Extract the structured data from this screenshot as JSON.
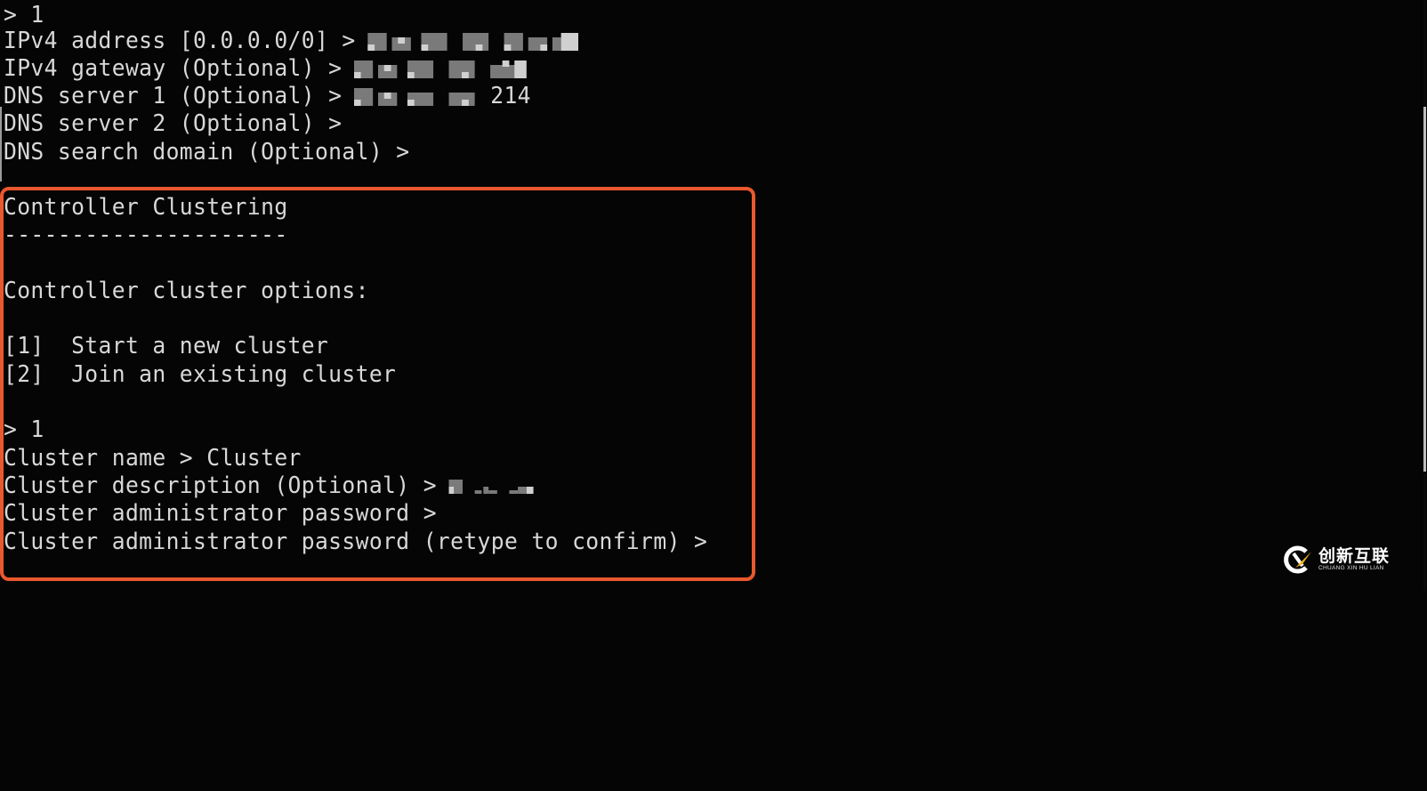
{
  "terminal": {
    "lines": [
      {
        "text": "> 1",
        "redacted": false
      },
      {
        "text": "IPv4 address [0.0.0.0/0] >",
        "redacted": true,
        "value_note": "redacted IP address"
      },
      {
        "text": "IPv4 gateway (Optional) >",
        "redacted": true,
        "value_note": "redacted IP address"
      },
      {
        "text": "DNS server 1 (Optional) >",
        "redacted": true,
        "value_suffix": "214"
      },
      {
        "text": "DNS server 2 (Optional) >",
        "redacted": false
      },
      {
        "text": "DNS search domain (Optional) >",
        "redacted": false
      },
      {
        "text": "",
        "redacted": false
      },
      {
        "text": "Controller Clustering",
        "redacted": false
      },
      {
        "text": "---------------------",
        "redacted": false
      },
      {
        "text": "",
        "redacted": false
      },
      {
        "text": "Controller cluster options:",
        "redacted": false
      },
      {
        "text": "",
        "redacted": false
      },
      {
        "text": "[1]  Start a new cluster",
        "redacted": false
      },
      {
        "text": "[2]  Join an existing cluster",
        "redacted": false
      },
      {
        "text": "",
        "redacted": false
      },
      {
        "text": "> 1",
        "redacted": false
      },
      {
        "text": "Cluster name > Cluster",
        "redacted": false
      },
      {
        "text": "Cluster description (Optional) >",
        "redacted": true,
        "value_note": "redacted description"
      },
      {
        "text": "Cluster administrator password >",
        "redacted": false
      },
      {
        "text": "Cluster administrator password (retype to confirm) >",
        "redacted": false
      }
    ]
  },
  "highlight": {
    "label": "Controller Clustering section",
    "color": "#e9582e"
  },
  "watermark": {
    "brand_cn": "创新互联",
    "brand_en": "CHUANG XIN HU LIAN",
    "logo_icon": "cx-logo-icon"
  },
  "colors": {
    "background": "#050505",
    "text": "#d8d8d8",
    "accent": "#e9582e",
    "logo_yellow": "#f2b41c"
  }
}
